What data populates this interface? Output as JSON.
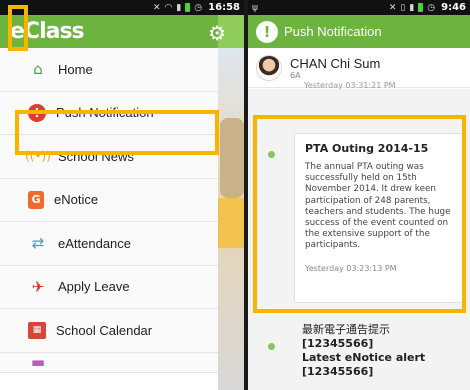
{
  "left_screen": {
    "status_time": "16:58",
    "app_logo": "eClass",
    "menu": [
      {
        "label": "Home",
        "icon": "home-icon",
        "color": "#3aa54a"
      },
      {
        "label": "Push Notification",
        "icon": "alert-icon",
        "color": "#e23b2f"
      },
      {
        "label": "School News",
        "icon": "broadcast-icon",
        "color": "#e6a817"
      },
      {
        "label": "eNotice",
        "icon": "notice-icon",
        "color": "#f06b2a"
      },
      {
        "label": "eAttendance",
        "icon": "swap-arrows-icon",
        "color": "#3aa0c8"
      },
      {
        "label": "Apply Leave",
        "icon": "leave-icon",
        "color": "#d6362c"
      },
      {
        "label": "School Calendar",
        "icon": "calendar-icon",
        "color": "#d8453a"
      }
    ]
  },
  "right_screen": {
    "status_time": "9:46",
    "title": "Push Notification",
    "sender": {
      "name": "CHAN Chi Sum",
      "class": "6A"
    },
    "cutoff_text": "Yesterday 03:31:21 PM",
    "card1": {
      "title": "PTA Outing 2014-15",
      "body": "The annual PTA outing was successfully held on 15th November 2014. It drew keen participation of 248 parents, teachers and students. The huge success of the event counted on the extensive support of the participants.",
      "time": "Yesterday 03:23:13 PM"
    },
    "card2": {
      "line1": "最新電子通告提示",
      "line2": "[12345566]",
      "line3": "Latest eNotice alert",
      "line4": "[12345566]"
    }
  },
  "colors": {
    "brand_green": "#6db33f",
    "highlight": "#f7b500"
  }
}
